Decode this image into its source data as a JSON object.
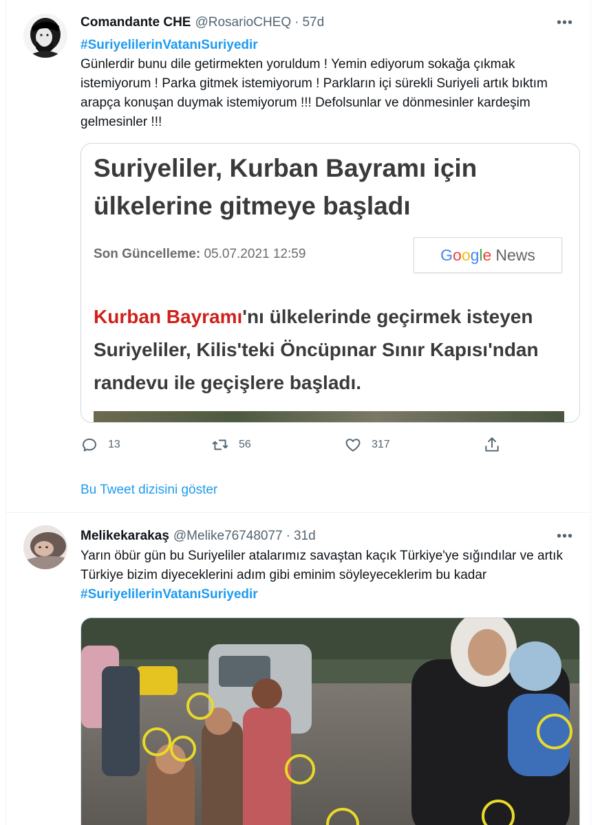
{
  "tweets": [
    {
      "display_name": "Comandante CHE",
      "handle": "@RosarioCHEQ",
      "separator": "·",
      "time": "57d",
      "more": "•••",
      "hashtag": "#SuriyelilerinVatanıSuriyedir",
      "text": "Günlerdir bunu dile getirmekten yoruldum ! Yemin ediyorum sokağa çıkmak istemiyorum ! Parka gitmek istemiyorum ! Parkların içi sürekli Suriyeli artık bıktım arapça konuşan duymak istemiyorum !!! Defolsunlar ve dönmesinler kardeşim gelmesinler !!!",
      "card": {
        "headline": "Suriyeliler, Kurban Bayramı için ülkelerine gitmeye başladı",
        "updated_label": "Son Güncelleme:",
        "updated_value": "05.07.2021 12:59",
        "badge_news": "News",
        "body_highlight": "Kurban Bayramı",
        "body_rest": "'nı ülkelerinde geçirmek isteyen Suriyeliler, Kilis'teki Öncüpınar Sınır Kapısı'ndan randevu ile geçişlere başladı."
      },
      "actions": {
        "replies": "13",
        "retweets": "56",
        "likes": "317"
      },
      "thread_link": "Bu Tweet dizisini göster"
    },
    {
      "display_name": "Melikekarakaş",
      "handle": "@Melike76748077",
      "separator": "·",
      "time": "31d",
      "more": "•••",
      "text": "Yarın öbür gün bu Suriyeliler atalarımız savaştan kaçık Türkiye'ye sığındılar ve artık Türkiye bizim diyeceklerini adım gibi eminim söyleyeceklerim bu kadar ",
      "hashtag": "#SuriyelilerinVatanıSuriyedir",
      "photo_markers": [
        "1",
        "2",
        "3",
        "4",
        "5",
        "6",
        "7"
      ]
    }
  ],
  "colors": {
    "link": "#1d9bf0",
    "text": "#0f1419",
    "muted": "#536471",
    "news_red": "#d0201a"
  }
}
